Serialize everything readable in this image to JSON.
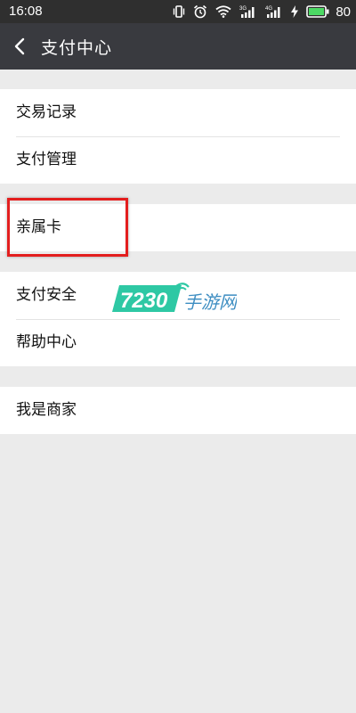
{
  "status_bar": {
    "time": "16:08",
    "network_labels": [
      "3G",
      "4G"
    ],
    "battery": "80",
    "icons": [
      "vibrate-icon",
      "alarm-icon",
      "wifi-icon",
      "signal-3g-icon",
      "signal-4g-icon",
      "charging-icon",
      "battery-icon"
    ]
  },
  "header": {
    "title": "支付中心",
    "back_icon": "back-arrow-icon"
  },
  "menu_groups": [
    {
      "items": [
        "交易记录",
        "支付管理"
      ]
    },
    {
      "items": [
        "亲属卡"
      ]
    },
    {
      "items": [
        "支付安全",
        "帮助中心"
      ]
    },
    {
      "items": [
        "我是商家"
      ]
    }
  ],
  "highlighted_item": "亲属卡",
  "watermark": {
    "number": "7230",
    "text": "手游网",
    "accent_color": "#2ec8a4"
  },
  "colors": {
    "status_bar": "#2f2f2f",
    "header": "#393a3f",
    "background": "#ebebeb",
    "highlight": "#e31e1e"
  }
}
